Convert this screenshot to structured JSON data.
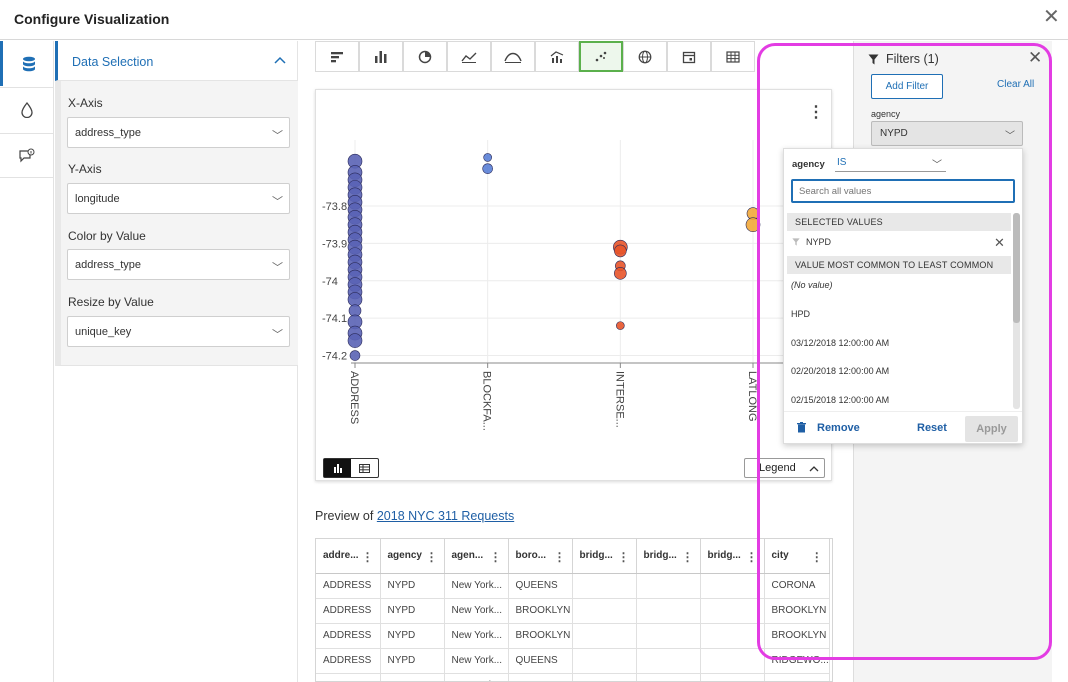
{
  "dialog": {
    "title": "Configure Visualization"
  },
  "sidebar_rail": {
    "items": [
      {
        "icon": "database-icon"
      },
      {
        "icon": "droplet-icon"
      },
      {
        "icon": "comment-info-icon"
      }
    ]
  },
  "data_selection": {
    "title": "Data Selection",
    "fields": [
      {
        "label": "X-Axis",
        "value": "address_type"
      },
      {
        "label": "Y-Axis",
        "value": "longitude"
      },
      {
        "label": "Color by Value",
        "value": "address_type"
      },
      {
        "label": "Resize by Value",
        "value": "unique_key"
      }
    ]
  },
  "toolbar": {
    "chart_types": [
      "bar-horizontal",
      "bar-vertical",
      "pie",
      "line",
      "area",
      "combo",
      "scatter",
      "map",
      "calendar",
      "table"
    ],
    "selected": "scatter"
  },
  "chart_data": {
    "type": "scatter",
    "categories": [
      "ADDRESS",
      "BLOCKFA...",
      "INTERSE...",
      "LATLONG"
    ],
    "yticks": [
      -73.8,
      -73.9,
      -74,
      -74.1,
      -74.2
    ],
    "ytick_labels": [
      "-73.8",
      "-73.9",
      "-74",
      "-74.1",
      "-74.2"
    ],
    "ylim": [
      -74.22,
      -73.65
    ],
    "series": [
      {
        "category": "ADDRESS",
        "color": "#5a63b5",
        "points": [
          {
            "y": -73.68,
            "s": 7
          },
          {
            "y": -73.71,
            "s": 7
          },
          {
            "y": -73.73,
            "s": 7
          },
          {
            "y": -73.75,
            "s": 7
          },
          {
            "y": -73.77,
            "s": 7
          },
          {
            "y": -73.79,
            "s": 7
          },
          {
            "y": -73.81,
            "s": 7
          },
          {
            "y": -73.83,
            "s": 7
          },
          {
            "y": -73.85,
            "s": 7
          },
          {
            "y": -73.87,
            "s": 7
          },
          {
            "y": -73.89,
            "s": 7
          },
          {
            "y": -73.91,
            "s": 7
          },
          {
            "y": -73.93,
            "s": 7
          },
          {
            "y": -73.95,
            "s": 7
          },
          {
            "y": -73.97,
            "s": 7
          },
          {
            "y": -73.99,
            "s": 7
          },
          {
            "y": -74.01,
            "s": 7
          },
          {
            "y": -74.03,
            "s": 7
          },
          {
            "y": -74.05,
            "s": 7
          },
          {
            "y": -74.08,
            "s": 6
          },
          {
            "y": -74.11,
            "s": 7
          },
          {
            "y": -74.14,
            "s": 7
          },
          {
            "y": -74.16,
            "s": 7
          },
          {
            "y": -74.2,
            "s": 5
          }
        ]
      },
      {
        "category": "BLOCKFA...",
        "color": "#5a7fd6",
        "points": [
          {
            "y": -73.67,
            "s": 4
          },
          {
            "y": -73.7,
            "s": 5
          }
        ]
      },
      {
        "category": "INTERSE...",
        "color": "#e8542a",
        "points": [
          {
            "y": -73.91,
            "s": 7
          },
          {
            "y": -73.92,
            "s": 6
          },
          {
            "y": -73.96,
            "s": 5
          },
          {
            "y": -73.98,
            "s": 6
          },
          {
            "y": -74.12,
            "s": 4
          }
        ]
      },
      {
        "category": "LATLONG",
        "color": "#f2a83a",
        "points": [
          {
            "y": -73.82,
            "s": 6
          },
          {
            "y": -73.85,
            "s": 7
          }
        ]
      }
    ]
  },
  "chart_controls": {
    "legend_label": "Legend"
  },
  "preview": {
    "prefix": "Preview of ",
    "dataset": "2018 NYC 311 Requests"
  },
  "table": {
    "columns": [
      "addre...",
      "agency",
      "agen...",
      "boro...",
      "bridg...",
      "bridg...",
      "bridg...",
      "city"
    ],
    "rows": [
      [
        "ADDRESS",
        "NYPD",
        "New York...",
        "QUEENS",
        "",
        "",
        "",
        "CORONA"
      ],
      [
        "ADDRESS",
        "NYPD",
        "New York...",
        "BROOKLYN",
        "",
        "",
        "",
        "BROOKLYN"
      ],
      [
        "ADDRESS",
        "NYPD",
        "New York...",
        "BROOKLYN",
        "",
        "",
        "",
        "BROOKLYN"
      ],
      [
        "ADDRESS",
        "NYPD",
        "New York...",
        "QUEENS",
        "",
        "",
        "",
        "RIDGEWO..."
      ],
      [
        "ADDRESS",
        "NYPD",
        "New York...",
        "QUEENS",
        "",
        "",
        "",
        "MASPETH"
      ]
    ]
  },
  "filters_panel": {
    "title": "Filters (1)",
    "add_filter": "Add Filter",
    "clear_all": "Clear All",
    "filter_label": "agency",
    "filter_value": "NYPD"
  },
  "filter_popup": {
    "field": "agency",
    "operator": "IS",
    "search_placeholder": "Search all values",
    "selected_header": "SELECTED VALUES",
    "selected_values": [
      "NYPD"
    ],
    "common_header": "VALUE MOST COMMON TO LEAST COMMON",
    "values": [
      "(No value)",
      "HPD",
      "03/12/2018 12:00:00 AM",
      "02/20/2018 12:00:00 AM",
      "02/15/2018 12:00:00 AM"
    ],
    "remove": "Remove",
    "reset": "Reset",
    "apply": "Apply"
  },
  "colors": {
    "accent": "#1f6fb5",
    "highlight": "#e33ce3",
    "selected_chart_type": "#5bb04c"
  }
}
